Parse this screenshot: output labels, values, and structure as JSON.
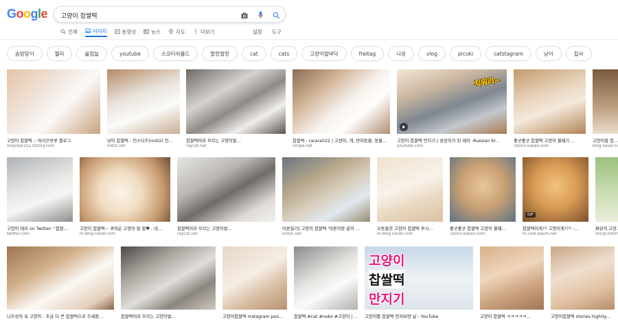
{
  "logo": "Google",
  "colors": {
    "blue": "#4285F4",
    "red": "#EA4335",
    "yellow": "#FBBC05",
    "green": "#34A853",
    "accent": "#1a73e8"
  },
  "search": {
    "value": "고양이 찹쌀떡",
    "icons": [
      "camera-icon",
      "microphone-icon",
      "search-icon"
    ]
  },
  "tabs": [
    {
      "label": "전체",
      "icon": "search-icon",
      "active": false
    },
    {
      "label": "이미지",
      "icon": "image-icon",
      "active": true
    },
    {
      "label": "동영상",
      "icon": "video-icon",
      "active": false
    },
    {
      "label": "뉴스",
      "icon": "news-icon",
      "active": false
    },
    {
      "label": "지도",
      "icon": "map-pin-icon",
      "active": false
    },
    {
      "label": "더보기",
      "icon": "more-vertical-icon",
      "active": false
    }
  ],
  "tools": {
    "settings": "설정",
    "tools": "도구"
  },
  "chips": [
    "솜방망이",
    "젤리",
    "울림늘",
    "youtube",
    "스코티쉬폴드",
    "말랑말랑",
    "cat",
    "cats",
    "고양이발바닥",
    "freitag",
    "나옹",
    "vlog",
    "picuki",
    "catstagram",
    "냥이",
    "집사"
  ],
  "results": [
    {
      "caption": "고양이 찹쌀떡 :: 머리끈루루 블로그",
      "source": "snkjvljer251.tistory.com"
    },
    {
      "caption": "냥이 찹쌀떡 - 인스티즈(instiz) 인…",
      "source": "instiz.net"
    },
    {
      "caption": "찹쌀떡이라 부르는 고양이발…",
      "source": "raycat.net"
    },
    {
      "caption": "찹쌀떡 - rarara022 | 고양이, 개, 반려동물, 동물…",
      "source": "vingle.net"
    },
    {
      "caption": "고양이 찹쌀떡 만지기 / 숭잉이가 된 레이 -Russian bl…",
      "source": "youtube.com",
      "overlay": "치워라~",
      "play": true
    },
    {
      "caption": "좋긋좋긋 찹쌀떡 고양이 볼때기 …",
      "source": "1boon.kakao.com"
    },
    {
      "caption": "고양이발 찹…",
      "source": "blog.naver.com"
    },
    {
      "caption": "고양이 태리 on Twitter: \"찹쌀…",
      "source": "twitter.com"
    },
    {
      "caption": "고양이 찹쌀떡~ 귀여운 고양이 발 할♥ : 네…",
      "source": "m.blog.naver.com"
    },
    {
      "caption": "찹쌀떡이라 부르는 고양이발…",
      "source": "raycat.net"
    },
    {
      "caption": "이론밀기] 고양이 찹쌀떡 '이론이랑 같이 …",
      "source": "onfun.net"
    },
    {
      "caption": "오동통한 고양이 찹쌀떡 루시…",
      "source": "m.blog.naver.com"
    },
    {
      "caption": "좋긋좋긋 찹쌀떡 고양이 볼때…",
      "source": "1boon.kakao.com"
    },
    {
      "caption": "찹쌀떡이게?? 고양이게??? -…",
      "source": "m.cafe.daum.net",
      "gif": "GIF"
    },
    {
      "caption": "쩌뮤의 고양…",
      "source": "lincat.tistory"
    },
    {
      "caption": "나무상자 속 고양이 - 조금 더 큰 찹쌀떡으로 주세용…",
      "source": ""
    },
    {
      "caption": "찹쌀떡이라 부르는 고양이발…",
      "source": ""
    },
    {
      "caption": "고양이찹쌀떡 Instagram pos…",
      "source": ""
    },
    {
      "caption": "찹쌀떡 #cat #neko #고양이 | …",
      "source": ""
    },
    {
      "caption": "고양이를 찹쌀떡 먼저보면 날 - YouTube",
      "source": "",
      "overlay_lines": [
        "고양이",
        "찹쌀떡",
        "만지기"
      ]
    },
    {
      "caption": "고양이 찹쌀떡 ㅋㅋㅋㅋㅋ…",
      "source": ""
    },
    {
      "caption": "고양이찹쌀떡 stories highlig…",
      "source": ""
    }
  ]
}
